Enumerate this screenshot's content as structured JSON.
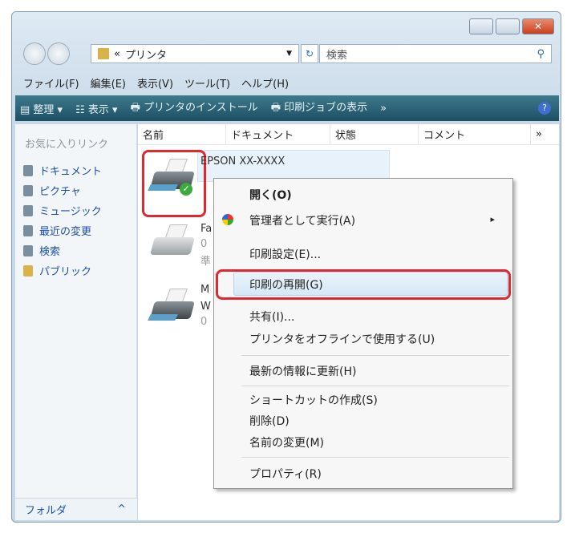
{
  "window": {
    "controls": [
      "minimize",
      "maximize",
      "close"
    ]
  },
  "address": {
    "prefix": "«",
    "path": "プリンタ",
    "search_placeholder": "検索"
  },
  "menubar": [
    "ファイル(F)",
    "編集(E)",
    "表示(V)",
    "ツール(T)",
    "ヘルプ(H)"
  ],
  "toolbar": {
    "organize": "整理 ▾",
    "views": "表示 ▾",
    "install": "プリンタのインストール",
    "jobs": "印刷ジョブの表示",
    "more": "»"
  },
  "sidebar": {
    "header": "お気に入りリンク",
    "items": [
      "ドキュメント",
      "ピクチャ",
      "ミュージック",
      "最近の変更",
      "検索",
      "パブリック"
    ],
    "folders": "フォルダ",
    "folders_chevron": "^"
  },
  "columns": [
    "名前",
    "ドキュメント",
    "状態",
    "コメント",
    "»"
  ],
  "printers": [
    {
      "name": "EPSON XX-XXXX"
    },
    {
      "name": "Fa",
      "line2": "0",
      "line3": "準"
    },
    {
      "name": "M",
      "line2": "W",
      "line3": "0"
    }
  ],
  "context_menu": {
    "items": [
      "開く(O)",
      "管理者として実行(A)",
      "印刷設定(E)...",
      "印刷の再開(G)",
      "共有(I)...",
      "プリンタをオフラインで使用する(U)",
      "最新の情報に更新(H)",
      "ショートカットの作成(S)",
      "削除(D)",
      "名前の変更(M)",
      "プロパティ(R)"
    ],
    "submenu_arrow": "▸"
  }
}
